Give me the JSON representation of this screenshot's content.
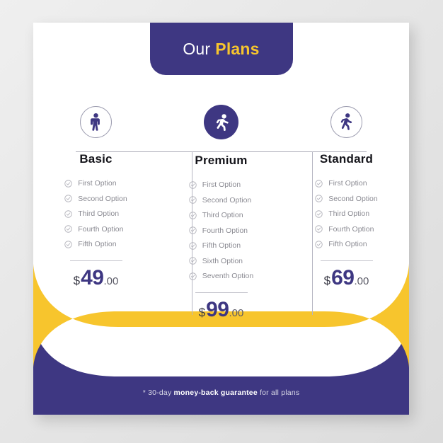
{
  "theme": {
    "purple": "#3e3782",
    "yellow": "#f7c52d",
    "card_bg": "#ffffff",
    "page_bg": "#e8e8e8",
    "muted_text": "#8b8b93",
    "title_text": "#14141a"
  },
  "header": {
    "title_light": "Our",
    "title_bold": "Plans"
  },
  "plans": [
    {
      "id": "basic",
      "title": "Basic",
      "icon": "person-standing-icon",
      "featured": false,
      "features": [
        "First Option",
        "Second Option",
        "Third Option",
        "Fourth Option",
        "Fifth Option"
      ],
      "price": {
        "currency": "$",
        "amount": "49",
        "cents": ".00"
      }
    },
    {
      "id": "premium",
      "title": "Premium",
      "icon": "person-running-icon",
      "featured": true,
      "features": [
        "First Option",
        "Second Option",
        "Third Option",
        "Fourth Option",
        "Fifth Option",
        "Sixth Option",
        "Seventh Option"
      ],
      "price": {
        "currency": "$",
        "amount": "99",
        "cents": ".00"
      }
    },
    {
      "id": "standard",
      "title": "Standard",
      "icon": "person-walking-icon",
      "featured": false,
      "features": [
        "First Option",
        "Second Option",
        "Third Option",
        "Fourth Option",
        "Fifth Option"
      ],
      "price": {
        "currency": "$",
        "amount": "69",
        "cents": ".00"
      }
    }
  ],
  "footer": {
    "prefix": "* 30-day ",
    "emphasis": "money-back guarantee",
    "suffix": " for all plans"
  }
}
